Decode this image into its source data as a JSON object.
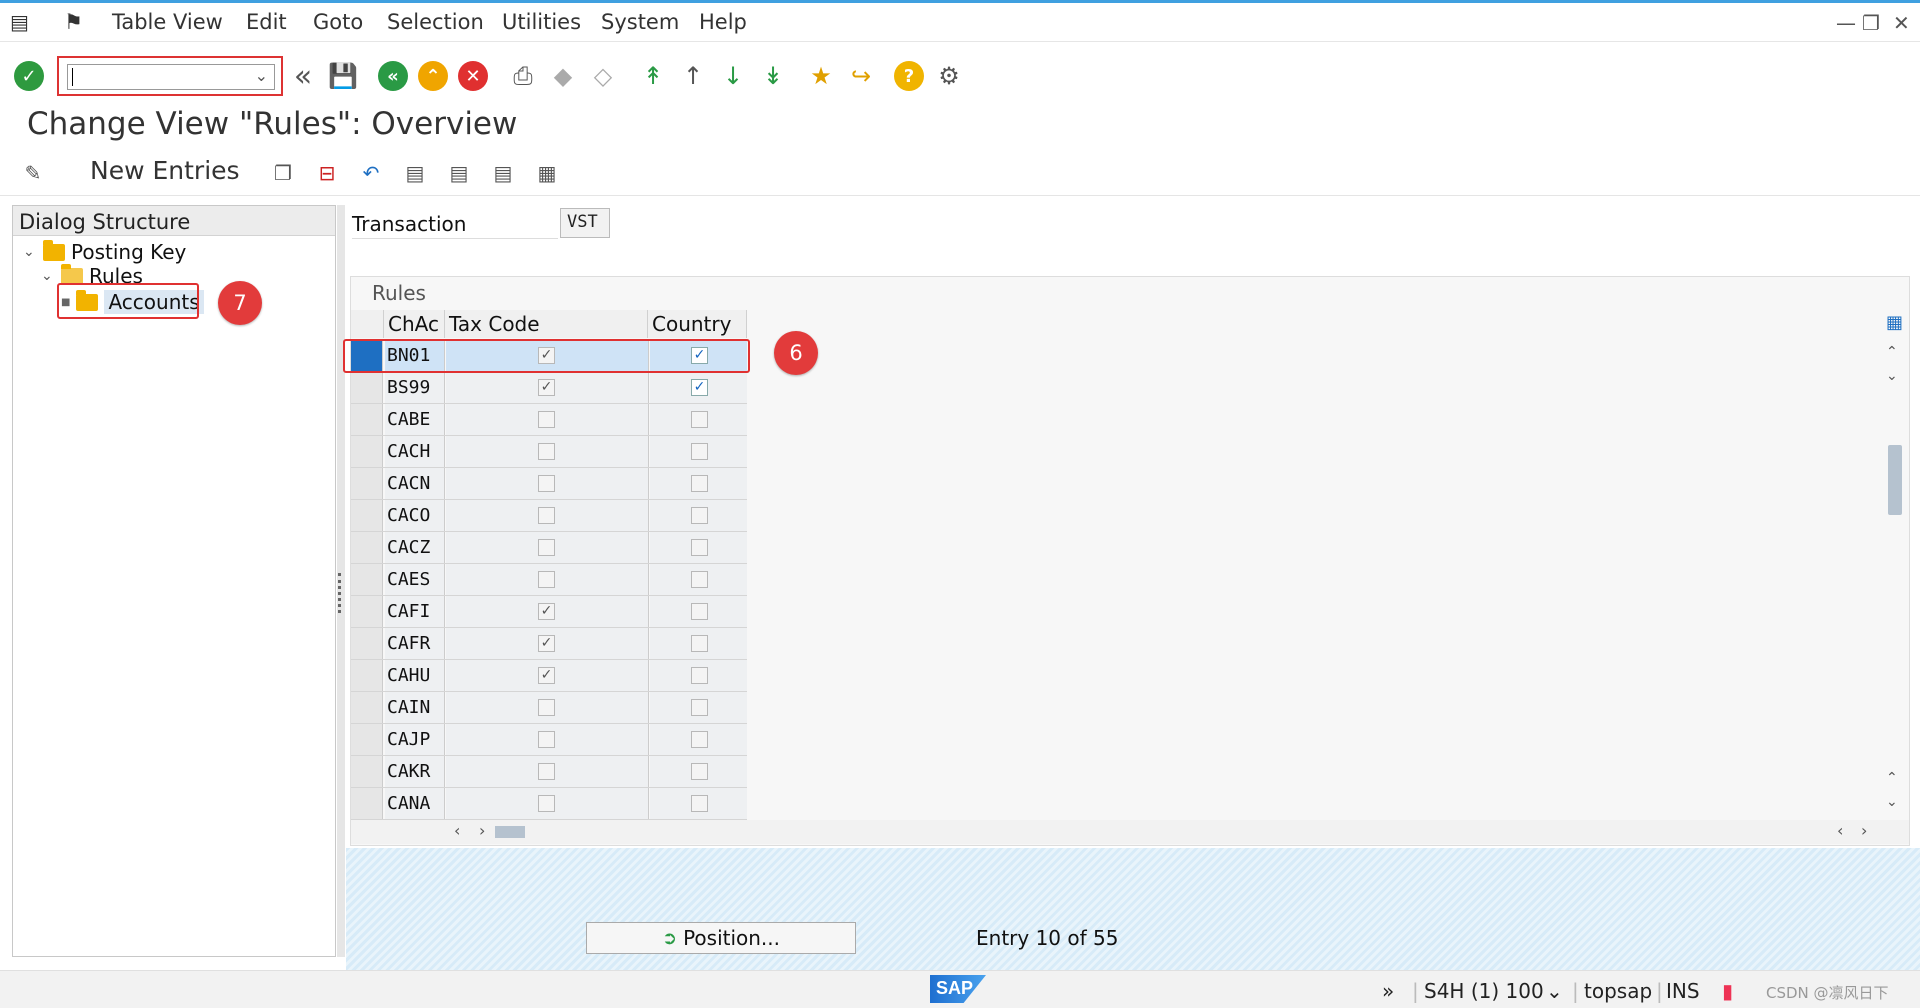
{
  "menu": {
    "items": [
      "Table View",
      "Edit",
      "Goto",
      "Selection",
      "Utilities",
      "System",
      "Help"
    ]
  },
  "toolbar": {
    "command_value": ""
  },
  "page_title": "Change View \"Rules\": Overview",
  "app_toolbar": {
    "new_entries_label": "New Entries"
  },
  "dialog_structure": {
    "header": "Dialog Structure",
    "nodes": [
      "Posting Key",
      "Rules",
      "Accounts"
    ],
    "selected": "Accounts"
  },
  "annotations": {
    "badge_accounts": "7",
    "badge_row": "6"
  },
  "transaction": {
    "label": "Transaction",
    "value": "VST"
  },
  "rules_table": {
    "title": "Rules",
    "columns": [
      "ChAc",
      "Tax Code",
      "Country"
    ],
    "rows": [
      {
        "chac": "BN01",
        "tax_code": true,
        "country": true,
        "selected": true
      },
      {
        "chac": "BS99",
        "tax_code": true,
        "country": true
      },
      {
        "chac": "CABE",
        "tax_code": false,
        "country": false
      },
      {
        "chac": "CACH",
        "tax_code": false,
        "country": false
      },
      {
        "chac": "CACN",
        "tax_code": false,
        "country": false
      },
      {
        "chac": "CACO",
        "tax_code": false,
        "country": false
      },
      {
        "chac": "CACZ",
        "tax_code": false,
        "country": false
      },
      {
        "chac": "CAES",
        "tax_code": false,
        "country": false
      },
      {
        "chac": "CAFI",
        "tax_code": true,
        "country": false
      },
      {
        "chac": "CAFR",
        "tax_code": true,
        "country": false
      },
      {
        "chac": "CAHU",
        "tax_code": true,
        "country": false
      },
      {
        "chac": "CAIN",
        "tax_code": false,
        "country": false
      },
      {
        "chac": "CAJP",
        "tax_code": false,
        "country": false
      },
      {
        "chac": "CAKR",
        "tax_code": false,
        "country": false
      },
      {
        "chac": "CANA",
        "tax_code": false,
        "country": false
      }
    ]
  },
  "position_button_label": "Position...",
  "entry_info": "Entry 10 of 55",
  "statusbar": {
    "system": "S4H (1) 100",
    "user": "topsap",
    "mode": "INS",
    "watermark": "CSDN @凛风日下"
  },
  "colors": {
    "accent": "#3fa0e0",
    "selected_row": "#cfe3f6",
    "annotation_red": "#e23b3b"
  }
}
